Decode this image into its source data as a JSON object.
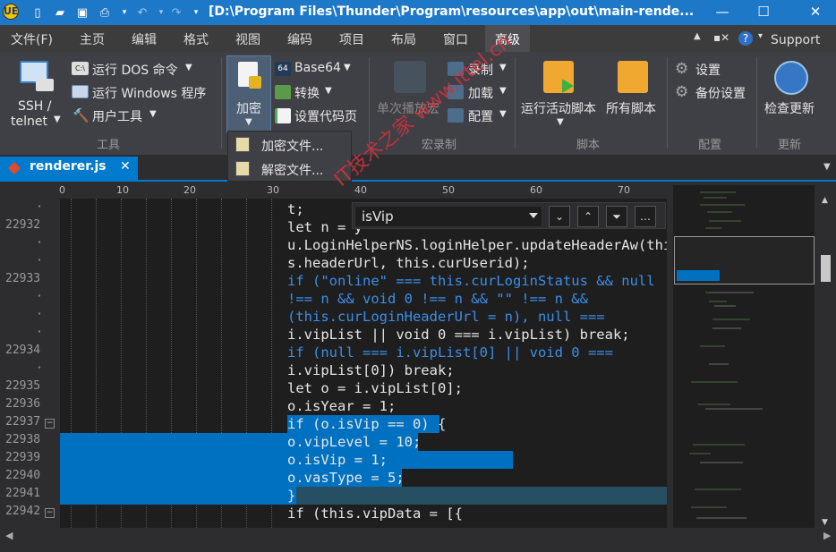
{
  "window": {
    "title": "[D:\\Program Files\\Thunder\\Program\\resources\\app\\out\\main-rende...",
    "controls": {
      "minimize": "—",
      "maximize": "☐",
      "close": "✕"
    }
  },
  "menu": {
    "items": [
      "文件(F)",
      "主页",
      "编辑",
      "格式",
      "视图",
      "编码",
      "项目",
      "布局",
      "窗口",
      "高级"
    ],
    "active": "高级",
    "support": "Support"
  },
  "ribbon": {
    "tools": {
      "ssh": "SSH /",
      "telnet": "telnet",
      "dos": "运行 DOS 命令",
      "windows": "运行 Windows 程序",
      "user_tools": "用户工具",
      "group": "工具"
    },
    "encrypt": {
      "label": "加密",
      "base64": "Base64",
      "convert": "转换",
      "set_code_page": "设置代码页"
    },
    "macro": {
      "play_once": "单次播放宏",
      "record": "录制",
      "load": "加载",
      "config": "配置",
      "group": "宏录制"
    },
    "script": {
      "run_active": "运行活动脚本",
      "all": "所有脚本",
      "group": "脚本"
    },
    "config": {
      "settings": "设置",
      "backup": "备份设置",
      "group": "配置"
    },
    "update": {
      "check": "检查更新",
      "group": "更新"
    }
  },
  "dropdown": {
    "items": [
      "加密文件...",
      "解密文件..."
    ]
  },
  "tab": {
    "name": "renderer.js",
    "close": "✕"
  },
  "ruler": {
    "labels": [
      "0",
      "10",
      "20",
      "30",
      "40",
      "50",
      "60",
      "70"
    ]
  },
  "find": {
    "value": "isVip",
    "buttons": [
      "⌄",
      "⌃",
      "⏷",
      "…"
    ]
  },
  "gutter": {
    "lines": [
      "·",
      "22932",
      "·",
      "·",
      "22933",
      "·",
      "·",
      "·",
      "22934",
      "·",
      "22935",
      "22936",
      "22937",
      "22938",
      "22939",
      "22940",
      "22941",
      "22942"
    ]
  },
  "code": {
    "lines": [
      "t;",
      "let n = y",
      "u.LoginHelperNS.loginHelper.updateHeaderAw(thi",
      "s.headerUrl, this.curUserid);",
      "if (\"online\" === this.curLoginStatus && null",
      "!== n && void 0 !== n && \"\" !== n &&",
      "(this.curLoginHeaderUrl = n), null ===",
      "i.vipList || void 0 === i.vipList) break;",
      "if (null === i.vipList[0] || void 0 ===",
      "i.vipList[0]) break;",
      "let o = i.vipList[0];",
      "o.isYear = 1;",
      "if (o.isVip == 0) {",
      "o.vipLevel = 10;",
      "o.isVip = 1;",
      "o.vasType = 5;",
      "}",
      "if (this.vipData = [{"
    ]
  },
  "watermark": "IT技术之家 www.ittel.cn",
  "colors": {
    "accent": "#007acc",
    "title_bar": "#1e78c8",
    "selection": "#0071c0",
    "keyword": "#3b8ee8"
  }
}
